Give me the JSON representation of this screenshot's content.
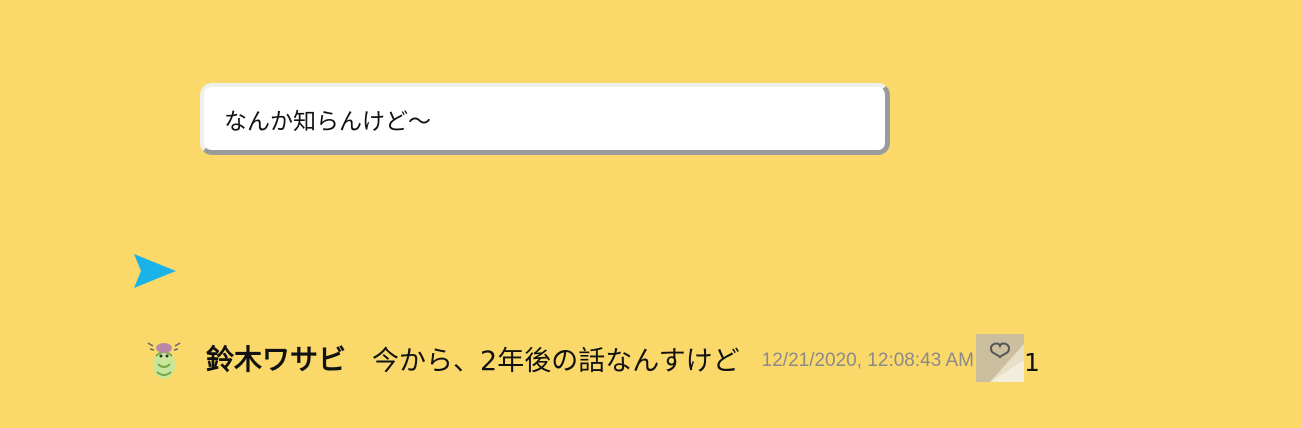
{
  "composer": {
    "input_value": "なんか知らんけど〜",
    "send_icon": "send-arrow-icon",
    "send_color": "#1ab3e8"
  },
  "messages": [
    {
      "username": "鈴木ワサビ",
      "text": "今から、2年後の話なんすけど",
      "timestamp": "12/21/2020, 12:08:43 AM",
      "like_icon": "heart-icon",
      "likes": "1"
    }
  ],
  "colors": {
    "background": "#fad96a",
    "timestamp": "#8a8a8a"
  }
}
